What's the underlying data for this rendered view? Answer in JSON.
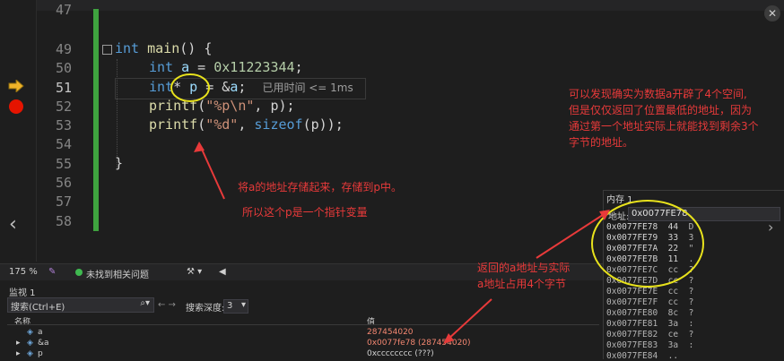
{
  "editor": {
    "line_numbers": [
      "47",
      "49",
      "50",
      "51",
      "52",
      "53",
      "54",
      "55",
      "56",
      "57",
      "58"
    ],
    "code": {
      "l49_kw": "int",
      "l49_fn": "main",
      "l49_rest": "() {",
      "l50_kw": "int",
      "l50_var": "a",
      "l50_eq": " = ",
      "l50_num": "0x11223344",
      "l50_end": ";",
      "l51_kw": "int",
      "l51_star": "* ",
      "l51_var": "p",
      "l51_eq": " = &",
      "l51_var2": "a",
      "l51_end": ";",
      "l51_hint": "已用时间 <= 1ms",
      "l52_fn": "printf",
      "l52_open": "(",
      "l52_str": "\"%p\\n\"",
      "l52_rest": ", p);",
      "l53_fn": "printf",
      "l53_open": "(",
      "l53_str": "\"%d\"",
      "l53_mid": ", ",
      "l53_kw": "sizeof",
      "l53_rest": "(p));",
      "l55": "}"
    }
  },
  "status_bar": {
    "zoom": "175 %",
    "issues": "未找到相关问题"
  },
  "watch": {
    "title": "监视 1",
    "search_placeholder": "搜索(Ctrl+E)",
    "depth_label": "搜索深度:",
    "depth_value": "3",
    "col_name": "名称",
    "col_value": "值",
    "rows": [
      {
        "name": "a",
        "value": "287454020"
      },
      {
        "name": "&a",
        "value": "0x0077fe78 (287454020)"
      },
      {
        "name": "p",
        "value": "0xcccccccc (???)"
      }
    ]
  },
  "memory": {
    "title": "内存 1",
    "addr_label": "地址:",
    "addr_value": "0x0077FE78",
    "rows": [
      {
        "addr": "0x0077FE78",
        "hex": "44",
        "ch": "D"
      },
      {
        "addr": "0x0077FE79",
        "hex": "33",
        "ch": "3"
      },
      {
        "addr": "0x0077FE7A",
        "hex": "22",
        "ch": "\""
      },
      {
        "addr": "0x0077FE7B",
        "hex": "11",
        "ch": "."
      },
      {
        "addr": "0x0077FE7C",
        "hex": "cc",
        "ch": "?"
      },
      {
        "addr": "0x0077FE7D",
        "hex": "cc",
        "ch": "?"
      },
      {
        "addr": "0x0077FE7E",
        "hex": "cc",
        "ch": "?"
      },
      {
        "addr": "0x0077FE7F",
        "hex": "cc",
        "ch": "?"
      },
      {
        "addr": "0x0077FE80",
        "hex": "8c",
        "ch": "?"
      },
      {
        "addr": "0x0077FE81",
        "hex": "3a",
        "ch": ":"
      },
      {
        "addr": "0x0077FE82",
        "hex": "ce",
        "ch": "?"
      },
      {
        "addr": "0x0077FE83",
        "hex": "3a",
        "ch": ":"
      },
      {
        "addr": "0x0077FE84",
        "hex": "..",
        "ch": ""
      }
    ]
  },
  "annotations": {
    "store_address": "将a的地址存储起来，存储到p中。",
    "pointer_var": "所以这个p是一个指针变量",
    "memory_note": "可以发现确实为数据a开辟了4个空间,\n但是仅仅返回了位置最低的地址，因为\n通过第一个地址实际上就能找到剩余3个\n字节的地址。",
    "return_note": "返回的a地址与实际\na地址占用4个字节"
  },
  "colors": {
    "annotation": "#e83a3a",
    "highlight_circle": "#e8e21c",
    "breakpoint": "#e51400",
    "change_bar": "#3fa33f"
  }
}
